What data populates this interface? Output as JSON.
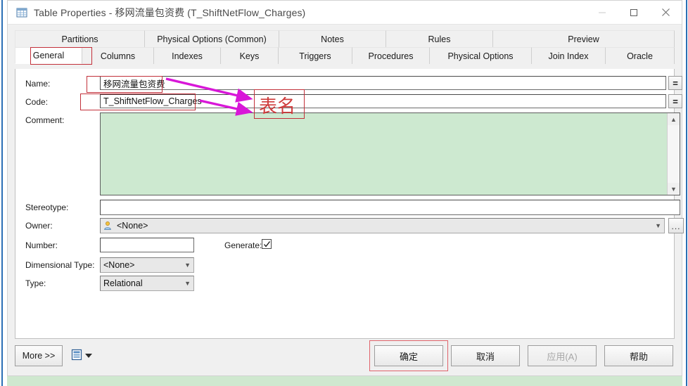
{
  "window": {
    "title": "Table Properties - 移网流量包资费 (T_ShiftNetFlow_Charges)",
    "icon": "table-icon",
    "minimize_label": "–",
    "maximize_label": "□",
    "close_label": "✕"
  },
  "tabs": {
    "row1": [
      {
        "label": "Partitions",
        "active": false
      },
      {
        "label": "Physical Options (Common)",
        "active": false
      },
      {
        "label": "Notes",
        "active": false
      },
      {
        "label": "Rules",
        "active": false
      },
      {
        "label": "Preview",
        "active": false
      }
    ],
    "row2": [
      {
        "label": "General",
        "active": true
      },
      {
        "label": "Columns",
        "active": false
      },
      {
        "label": "Indexes",
        "active": false
      },
      {
        "label": "Keys",
        "active": false
      },
      {
        "label": "Triggers",
        "active": false
      },
      {
        "label": "Procedures",
        "active": false
      },
      {
        "label": "Physical Options",
        "active": false
      },
      {
        "label": "Join Index",
        "active": false
      },
      {
        "label": "Oracle",
        "active": false
      }
    ]
  },
  "form": {
    "name_label": "Name:",
    "name_value": "移网流量包资费",
    "code_label": "Code:",
    "code_value": "T_ShiftNetFlow_Charges",
    "equals_button_label": "=",
    "comment_label": "Comment:",
    "comment_value": "",
    "stereotype_label": "Stereotype:",
    "stereotype_value": "",
    "owner_label": "Owner:",
    "owner_value": "<None>",
    "owner_icon": "user-icon",
    "owner_browse_label": "...",
    "number_label": "Number:",
    "number_value": "",
    "generate_label": "Generate:",
    "generate_checked": true,
    "dimensional_type_label": "Dimensional Type:",
    "dimensional_type_value": "<None>",
    "type_label": "Type:",
    "type_value": "Relational"
  },
  "annotations": {
    "table_name_note": "表名",
    "annotation_color": "#cf3b3b",
    "arrow_color": "#d817d8",
    "highlight_color": "#c2303a"
  },
  "footer": {
    "more_label": "More >>",
    "clipboard_icon": "clipboard-icon",
    "dropdown_icon": "caret-down-icon",
    "ok_label": "确定",
    "cancel_label": "取消",
    "apply_label": "应用(A)",
    "apply_disabled": true,
    "help_label": "帮助"
  },
  "colors": {
    "comment_background": "#cde9d0",
    "dialog_background": "#f0f0f0",
    "accent_blue": "#2a6fb5"
  }
}
